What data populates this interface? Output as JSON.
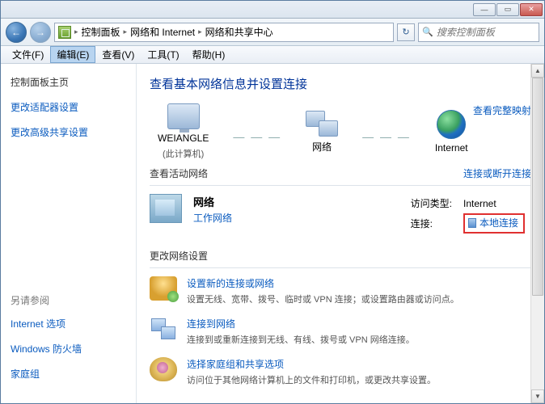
{
  "titlebar": {
    "min": "—",
    "max": "▭",
    "close": "✕"
  },
  "nav": {
    "back": "←",
    "forward": "→",
    "crumbs": [
      "控制面板",
      "网络和 Internet",
      "网络和共享中心"
    ],
    "sep": "▸",
    "refresh": "↻",
    "search_placeholder": "搜索控制面板"
  },
  "menu": {
    "file": "文件(F)",
    "edit": "编辑(E)",
    "view": "查看(V)",
    "tools": "工具(T)",
    "help": "帮助(H)"
  },
  "sidebar": {
    "home": "控制面板主页",
    "adapter": "更改适配器设置",
    "advanced": "更改高级共享设置",
    "see_also": "另请参阅",
    "opts": [
      "Internet 选项",
      "Windows 防火墙",
      "家庭组"
    ]
  },
  "content": {
    "heading": "查看基本网络信息并设置连接",
    "full_map": "查看完整映射",
    "map": {
      "pc_name": "WEIANGLE",
      "pc_sub": "(此计算机)",
      "net": "网络",
      "internet": "Internet"
    },
    "active_head": "查看活动网络",
    "disconnect": "连接或断开连接",
    "active": {
      "name": "网络",
      "type": "工作网络",
      "access_label": "访问类型:",
      "access_val": "Internet",
      "conn_label": "连接:",
      "conn_val": "本地连接"
    },
    "settings_head": "更改网络设置",
    "settings": [
      {
        "title": "设置新的连接或网络",
        "desc": "设置无线、宽带、拨号、临时或 VPN 连接；或设置路由器或访问点。"
      },
      {
        "title": "连接到网络",
        "desc": "连接到或重新连接到无线、有线、拨号或 VPN 网络连接。"
      },
      {
        "title": "选择家庭组和共享选项",
        "desc": "访问位于其他网络计算机上的文件和打印机，或更改共享设置。"
      }
    ]
  }
}
